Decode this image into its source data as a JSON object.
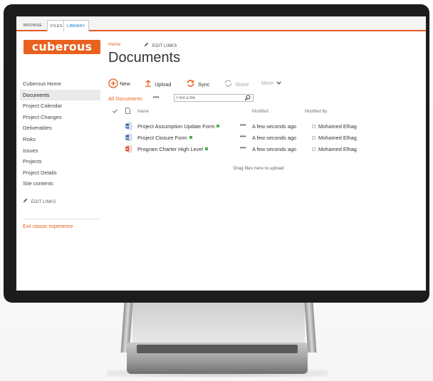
{
  "ribbon": {
    "tabs": [
      {
        "label": "BROWSE"
      },
      {
        "label": "FILES"
      },
      {
        "label": "LIBRARY"
      }
    ]
  },
  "site": {
    "logo_text": "cuberous",
    "brand_color": "#e8611f"
  },
  "nav": {
    "items": [
      {
        "label": "Cuberous Home"
      },
      {
        "label": "Documents"
      },
      {
        "label": "Project Calendar"
      },
      {
        "label": "Project Changes"
      },
      {
        "label": "Deliverables"
      },
      {
        "label": "Risks"
      },
      {
        "label": "Issues"
      },
      {
        "label": "Projects"
      },
      {
        "label": "Project Details"
      },
      {
        "label": "Site contents"
      }
    ],
    "edit_links": "EDIT LINKS",
    "exit_classic": "Exit classic experience"
  },
  "header": {
    "breadcrumb_home": "Home",
    "edit_links": "EDIT LINKS",
    "title": "Documents"
  },
  "commands": {
    "new": "New",
    "upload": "Upload",
    "sync": "Sync",
    "share": "Share",
    "more": "More"
  },
  "view": {
    "all_documents": "All Documents",
    "ellipsis": "•••",
    "search_placeholder": "Find a file"
  },
  "table": {
    "columns": {
      "name": "Name",
      "modified": "Modified",
      "modified_by": "Modified By"
    },
    "rows": [
      {
        "name": "Project Assumption Update Form",
        "type": "word-icon",
        "modified": "A few seconds ago",
        "modified_by": "Mohamed Elhag"
      },
      {
        "name": "Project Closure Form",
        "type": "word-icon",
        "modified": "A few seconds ago",
        "modified_by": "Mohamed Elhag"
      },
      {
        "name": "Program Charter High Level",
        "type": "powerpoint-icon",
        "modified": "A few seconds ago",
        "modified_by": "Mohamed Elhag"
      }
    ],
    "row_menu": "•••",
    "drag_hint": "Drag files here to upload"
  }
}
